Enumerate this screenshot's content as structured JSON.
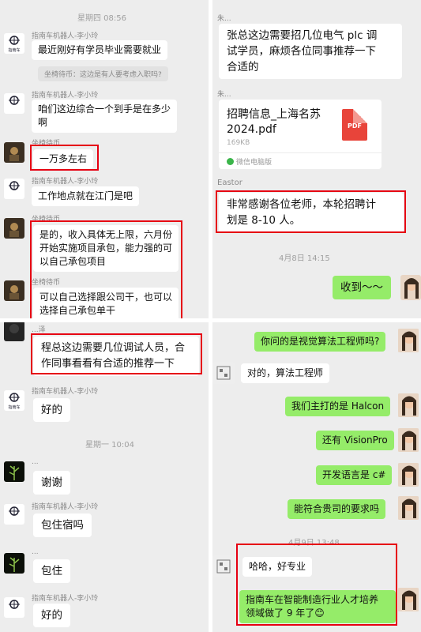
{
  "panel_tl": {
    "time": "星期四 08:56",
    "bot_name": "指南车机器人-李小玲",
    "msg1": "最近刚好有学员毕业需要就业",
    "recall": "坐椅待币：这边是有人要考虑入职吗?",
    "msg2a": "咱们这边综合一个到手是在多少",
    "msg2b": "啊",
    "user_name": "坐椅待币",
    "msg3": "一万多左右",
    "msg4": "工作地点就在江门是吧",
    "msg5a": "是的，收入具体无上限，六月份",
    "msg5b": "开始实施项目承包，能力强的可",
    "msg5c": "以自己承包项目",
    "msg6a": "可以自己选择跟公司干，也可以",
    "msg6b": "选择自己承包单干",
    "logo_text": "指南车"
  },
  "panel_tr": {
    "name1": "朱...",
    "msg1a": "张总这边需要招几位电气 plc 调",
    "msg1b": "试学员，麻烦各位同事推荐一下",
    "msg1c": "合适的",
    "name2": "朱...",
    "file_name_a": "招聘信息_上海名苏",
    "file_name_b": "2024.pdf",
    "file_size": "169KB",
    "file_icon_label": "PDF",
    "file_source": "微信电脑版",
    "name3": "Eastor",
    "msg2a": "非常感谢各位老师，本轮招聘计",
    "msg2b": "划是 8-10 人。",
    "time": "4月8日 14:15",
    "msg3": "收到～～"
  },
  "panel_bl": {
    "name1": "...泽",
    "msg1a": "程总这边需要几位调试人员，合",
    "msg1b": "作同事看看有合适的推荐一下",
    "bot_name": "指南车机器人-李小玲",
    "msg2": "好的",
    "time": "星期一 10:04",
    "msg3": "谢谢",
    "bot_name2": "指南车机器人-李小玲",
    "msg4": "包住宿吗",
    "name3": "...",
    "msg5": "包住",
    "bot_name3": "指南车机器人-李小玲",
    "msg6": "好的",
    "logo_text": "指南车"
  },
  "panel_br": {
    "msg1": "你问的是视觉算法工程师吗?",
    "msg2": "对的，算法工程师",
    "msg3": "我们主打的是 Halcon",
    "msg4": "还有 VisionPro",
    "msg5": "开发语言是 c#",
    "msg6": "能符合贵司的要求吗",
    "time": "4月9日 13:48",
    "msg7": "哈哈，好专业",
    "msg8a": "指南车在智能制造行业人才培养",
    "msg8b": "领域做了 9 年了",
    "emoji": "😊"
  },
  "colors": {
    "chat_bg": "#ededed",
    "my_bubble": "#95ec69",
    "their_bubble": "#ffffff",
    "highlight_box": "#e60012",
    "pdf_red": "#e8443a"
  }
}
